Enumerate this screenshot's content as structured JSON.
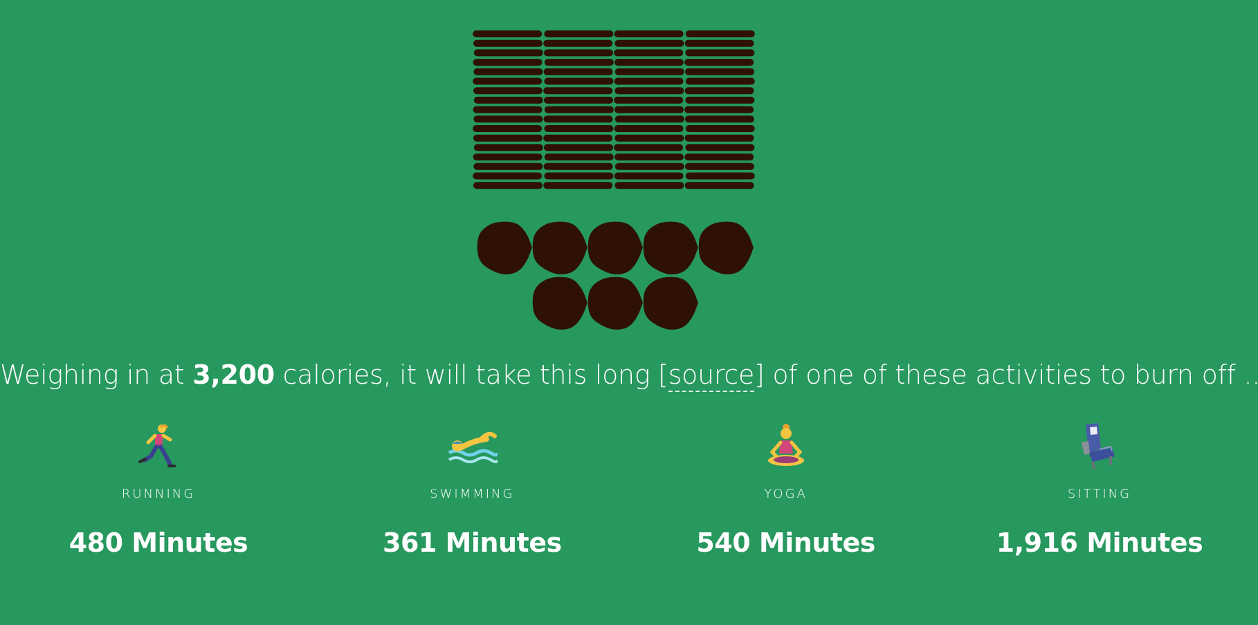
{
  "illustration": {
    "cookie_color": "#2e1104",
    "background_color": "#27985e",
    "stacked_wafers": 68,
    "whole_cookies": 8
  },
  "sentence": {
    "prefix": "Weighing in at",
    "calories": "3,200",
    "middle": "calories, it will take this long [",
    "source_label": "source",
    "suffix": "] of one of these activities to burn off ..."
  },
  "activities": [
    {
      "icon": "running-person-icon",
      "label": "RUNNING",
      "minutes": "480 Minutes"
    },
    {
      "icon": "swimming-person-icon",
      "label": "SWIMMING",
      "minutes": "361 Minutes"
    },
    {
      "icon": "yoga-person-icon",
      "label": "YOGA",
      "minutes": "540 Minutes"
    },
    {
      "icon": "seat-icon",
      "label": "SITTING",
      "minutes": "1,916 Minutes"
    }
  ]
}
